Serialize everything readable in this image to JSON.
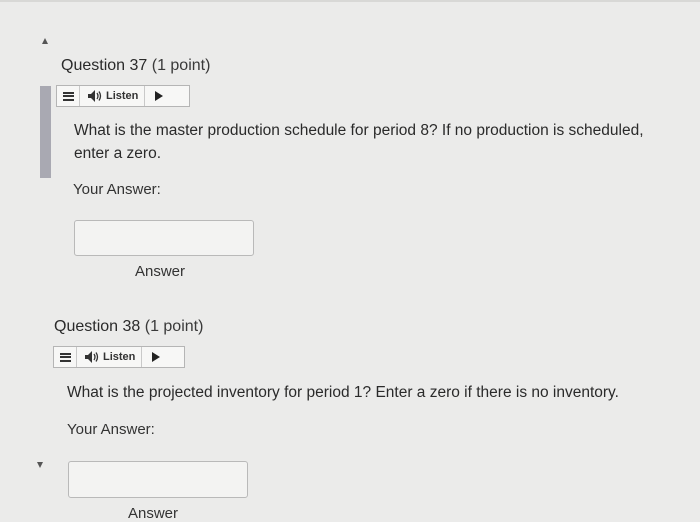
{
  "questions": [
    {
      "title": "Question 37",
      "points": "(1 point)",
      "listen_label": "Listen",
      "prompt_line1": "What is the master production schedule for period 8? If no production is scheduled,",
      "prompt_line2": "enter a zero.",
      "your_answer_label": "Your Answer:",
      "answer_value": "",
      "answer_caption": "Answer"
    },
    {
      "title": "Question 38",
      "points": "(1 point)",
      "listen_label": "Listen",
      "prompt_line1": "What is the projected inventory for period 1? Enter a zero if there is no inventory.",
      "your_answer_label": "Your Answer:",
      "answer_value": "",
      "answer_caption": "Answer"
    }
  ]
}
